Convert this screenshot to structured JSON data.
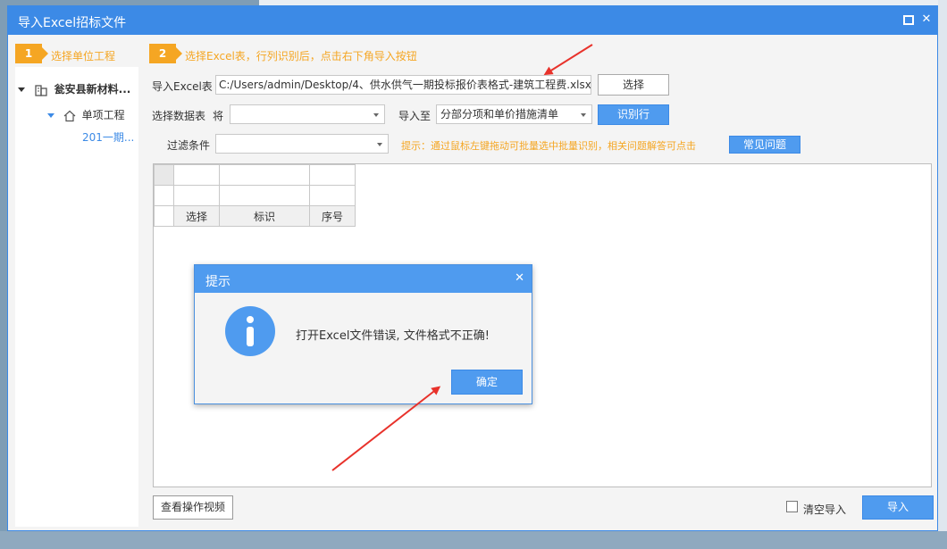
{
  "window": {
    "title": "导入Excel招标文件",
    "maximize_icon": "maximize-icon",
    "close_label": "✕"
  },
  "sidebar": {
    "step_number": "1",
    "step_label": "选择单位工程",
    "root_label": "瓮安县新材料...",
    "child_label": "单项工程",
    "leaf_label": "201一期..."
  },
  "step2": {
    "number": "2",
    "label": "选择Excel表，行列识别后，点击右下角导入按钮"
  },
  "form": {
    "import_excel_label": "导入Excel表",
    "import_excel_value": "C:/Users/admin/Desktop/4、供水供气一期投标报价表格式-建筑工程费.xlsx",
    "select_button": "选择",
    "select_sheet_label": "选择数据表",
    "will_label": "将",
    "sheet_value": "",
    "import_to_label": "导入至",
    "import_to_value": "分部分项和单价措施清单",
    "identify_button": "识别行",
    "filter_label": "过滤条件",
    "filter_value": "",
    "hint_text": "提示：通过鼠标左键拖动可批量选中批量识别，相关问题解答可点击",
    "faq_button": "常见问题"
  },
  "grid": {
    "headers": [
      "选择",
      "标识",
      "序号"
    ]
  },
  "dialog": {
    "title": "提示",
    "close_label": "✕",
    "message": "打开Excel文件错误, 文件格式不正确!",
    "ok_button": "确定"
  },
  "footer": {
    "video_button": "查看操作视频",
    "clear_import_label": "清空导入",
    "import_button": "导入"
  },
  "colors": {
    "accent": "#3c8ae6",
    "step": "#f5a623",
    "annotation_arrow": "#e8322b"
  }
}
